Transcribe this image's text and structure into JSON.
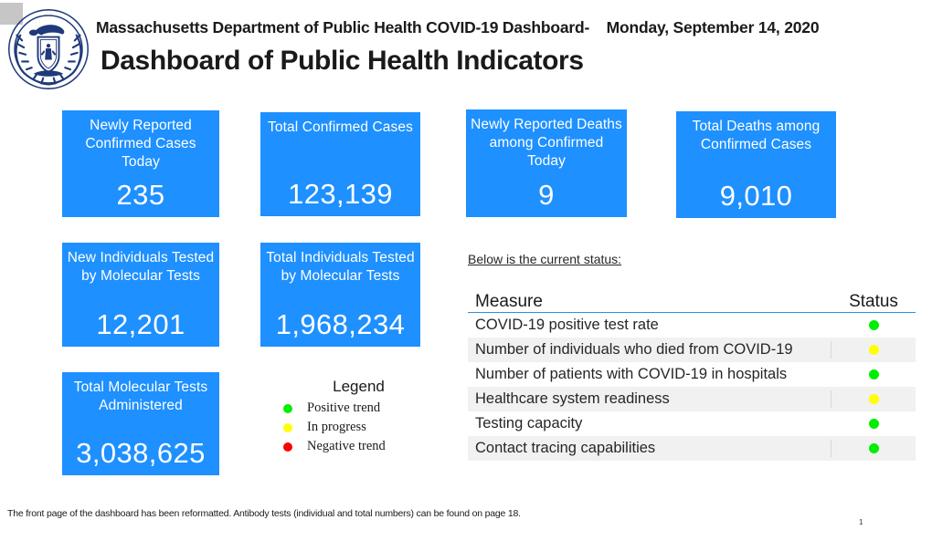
{
  "header": {
    "seal_icon": "massachusetts-dph-seal",
    "seal_outer_top_text": "COMMONWEALTH OF MASSACHUSETTS",
    "seal_outer_bottom_text": "DEPARTMENT OF PUBLIC HEALTH",
    "agency_line": "Massachusetts Department of Public Health COVID-19 Dashboard-",
    "date": "Monday, September 14, 2020",
    "title": "Dashboard of Public Health Indicators"
  },
  "colors": {
    "card_blue": "#1e90ff",
    "rule_blue": "#2f8fd8",
    "positive_green": "#00ee00",
    "in_progress_yellow": "#ffff00",
    "negative_red": "#ff0000",
    "row_alt_gray": "#f1f1f1"
  },
  "stat_cards": [
    {
      "label": "Newly Reported Confirmed Cases Today",
      "value": "235"
    },
    {
      "label": "Total Confirmed Cases",
      "value": "123,139"
    },
    {
      "label": "Newly Reported Deaths among Confirmed Today",
      "value": "9"
    },
    {
      "label": "Total Deaths among Confirmed Cases",
      "value": "9,010"
    },
    {
      "label": "New Individuals Tested by Molecular Tests",
      "value": "12,201"
    },
    {
      "label": "Total Individuals Tested by Molecular Tests",
      "value": "1,968,234"
    },
    {
      "label": "Total Molecular Tests Administered",
      "value": "3,038,625"
    }
  ],
  "legend": {
    "title": "Legend",
    "items": [
      {
        "label": "Positive trend",
        "color": "#00ee00",
        "icon": "green-dot-icon"
      },
      {
        "label": "In progress",
        "color": "#ffff00",
        "icon": "yellow-dot-icon"
      },
      {
        "label": "Negative trend",
        "color": "#ff0000",
        "icon": "red-dot-icon"
      }
    ]
  },
  "status_section": {
    "intro": "Below is the current status:",
    "columns": {
      "measure": "Measure",
      "status": "Status"
    },
    "rows": [
      {
        "measure": "COVID-19 positive test rate",
        "status_color": "#00ee00",
        "status_icon": "green-dot-icon"
      },
      {
        "measure": "Number of individuals who died from COVID-19",
        "status_color": "#ffff00",
        "status_icon": "yellow-dot-icon"
      },
      {
        "measure": "Number of patients with COVID-19 in hospitals",
        "status_color": "#00ee00",
        "status_icon": "green-dot-icon"
      },
      {
        "measure": "Healthcare system readiness",
        "status_color": "#ffff00",
        "status_icon": "yellow-dot-icon"
      },
      {
        "measure": "Testing capacity",
        "status_color": "#00ee00",
        "status_icon": "green-dot-icon"
      },
      {
        "measure": "Contact tracing capabilities",
        "status_color": "#00ee00",
        "status_icon": "green-dot-icon"
      }
    ]
  },
  "footer": {
    "note": "The front page of the dashboard has been reformatted. Antibody tests (individual and total numbers) can be found on page 18.",
    "page_number": "1"
  }
}
